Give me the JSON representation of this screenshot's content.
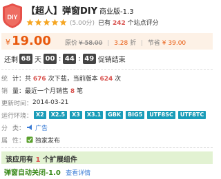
{
  "product": {
    "title": "【超人】弹窗DIY",
    "edition": "商业版-1.3",
    "logo_text": "DIY",
    "rating": {
      "stars": 5,
      "max_stars": 5,
      "score": "(5.00分)",
      "prefix": "已有",
      "count": "242",
      "suffix": "个站点评分"
    }
  },
  "price": {
    "currency": "¥",
    "current": "19.00",
    "original_label": "原价",
    "original": "¥ 58.00",
    "discount": "3.28",
    "discount_unit": "折",
    "save_label": "节省",
    "save": "¥ 39.00"
  },
  "countdown": {
    "prefix": "还剩",
    "days": "68",
    "days_unit": "天",
    "hours": "00",
    "minutes": "44",
    "seconds": "49",
    "suffix": "促销结束"
  },
  "info": {
    "stats_label": "统",
    "stats_a": "计：共",
    "downloads_total": "676",
    "stats_b": "次下载，当前版本",
    "downloads_version": "624",
    "stats_c": "次",
    "sales_label": "销",
    "sales_a": "量：最近一个月销售",
    "sales_month": "8",
    "sales_b": "笔",
    "updated_label": "更新时间：",
    "updated": "2014-03-21",
    "env_label": "运行环境：",
    "env_tags": [
      "X2",
      "X2.5",
      "X3",
      "X3.1",
      "GBK",
      "BIG5",
      "UTF8SC",
      "UTF8TC"
    ],
    "category_label": "分",
    "category_a": "类：",
    "category": "广告",
    "attr_label": "属",
    "attr_a": "性：",
    "attr": "独家发布"
  },
  "extension": {
    "text_a": "该应用有",
    "count": "1",
    "text_b": "个扩展组件",
    "plugin_name": "弹窗自动关闭-1.0",
    "plugin_link": "查看详情"
  },
  "colors": {
    "accent_orange": "#e8580c",
    "price_bg": "#fdf1e6",
    "tag_bg": "#1a9cb8",
    "ext_bg": "#e2f2d2",
    "link_green": "#3a8a1a",
    "link_blue": "#3a7bd5",
    "star": "#f5a623"
  }
}
